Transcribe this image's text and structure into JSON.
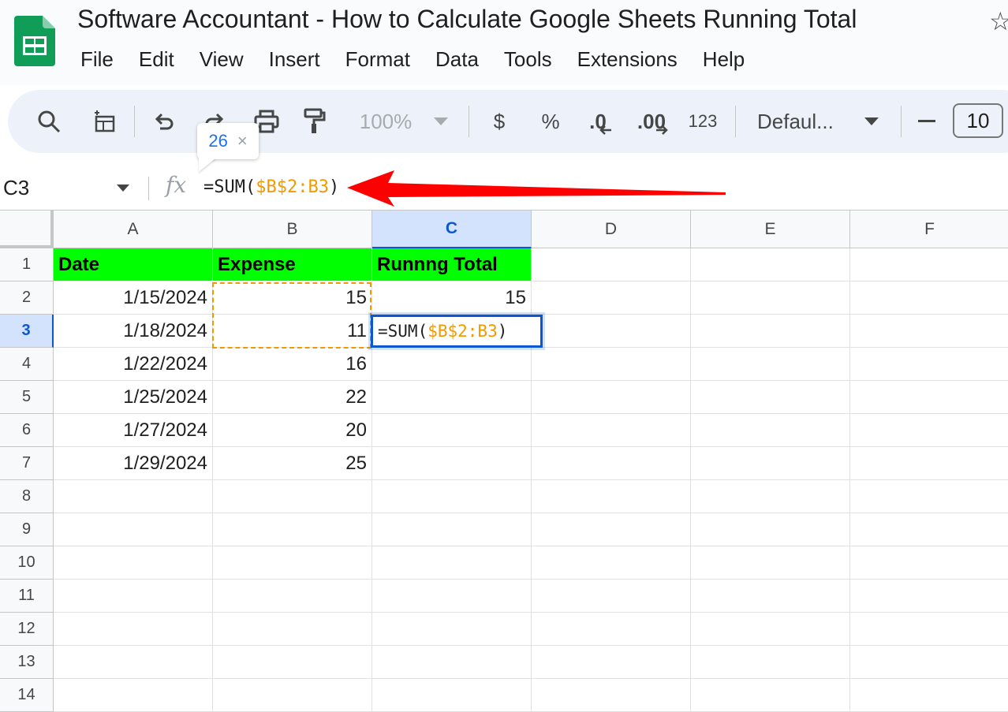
{
  "header": {
    "title": "Software Accountant - How to Calculate Google Sheets Running Total",
    "menu": [
      "File",
      "Edit",
      "View",
      "Insert",
      "Format",
      "Data",
      "Tools",
      "Extensions",
      "Help"
    ]
  },
  "toolbar": {
    "zoom": "100%",
    "currency": "$",
    "percent": "%",
    "decrease_decimal": ".0",
    "increase_decimal": ".00",
    "number_format": "123",
    "font": "Defaul...",
    "font_size": "10"
  },
  "tooltip": {
    "value": "26",
    "close": "×"
  },
  "formula_bar": {
    "name_box": "C3",
    "fx": "fx",
    "formula_prefix": "=SUM(",
    "formula_ref": "$B$2:B3",
    "formula_suffix": ")"
  },
  "grid": {
    "columns": [
      "A",
      "B",
      "C",
      "D",
      "E",
      "F"
    ],
    "rows": [
      "1",
      "2",
      "3",
      "4",
      "5",
      "6",
      "7",
      "8",
      "9",
      "10",
      "11",
      "12",
      "13",
      "14"
    ],
    "headers": {
      "date": "Date",
      "expense": "Expense",
      "running_total": "Runnng Total"
    },
    "data": [
      {
        "date": "1/15/2024",
        "expense": "15",
        "total": "15"
      },
      {
        "date": "1/18/2024",
        "expense": "11",
        "total": ""
      },
      {
        "date": "1/22/2024",
        "expense": "16",
        "total": ""
      },
      {
        "date": "1/25/2024",
        "expense": "22",
        "total": ""
      },
      {
        "date": "1/27/2024",
        "expense": "20",
        "total": ""
      },
      {
        "date": "1/29/2024",
        "expense": "25",
        "total": ""
      }
    ],
    "editing_cell": {
      "prefix": "=SUM(",
      "ref": "$B$2:B3",
      "suffix": ")"
    }
  },
  "colors": {
    "header_fill": "#00ff00",
    "reference": "#f29900",
    "selection": "#0b57d0",
    "arrow": "#ff0000"
  }
}
